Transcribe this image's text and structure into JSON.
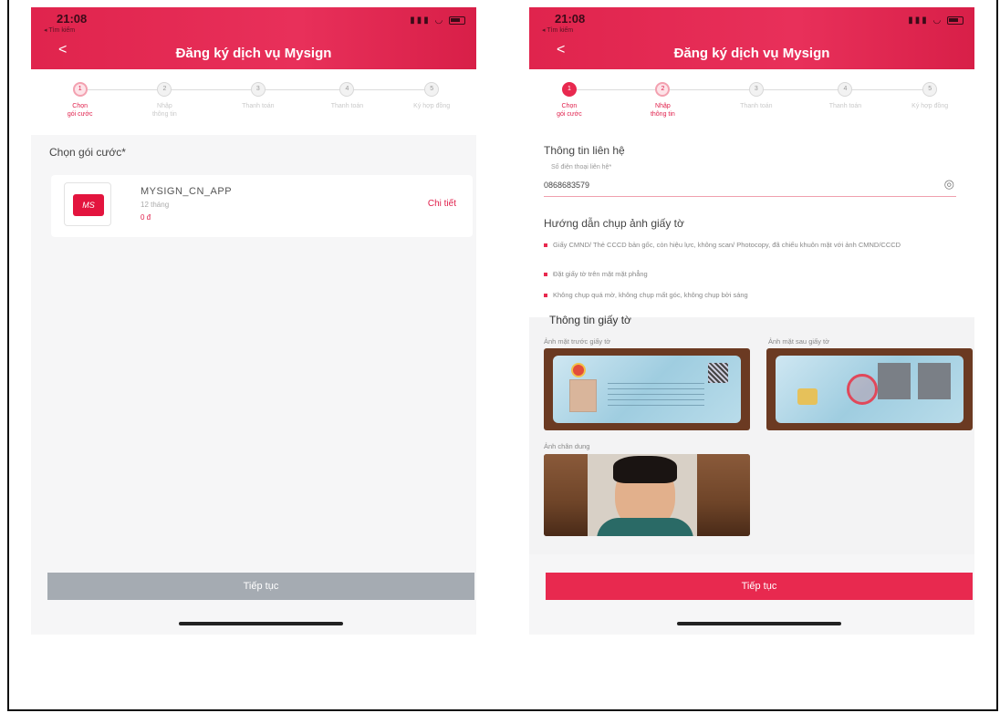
{
  "screens": [
    {
      "status_time": "21:08",
      "status_sub": "◂ Tìm kiếm",
      "header_title": "Đăng ký dịch vụ Mysign",
      "steps": [
        {
          "num": "1",
          "label": "Chọn\ngói cước",
          "state": "active"
        },
        {
          "num": "2",
          "label": "Nhập\nthông tin",
          "state": "pending"
        },
        {
          "num": "3",
          "label": "Thanh toán",
          "state": "pending"
        },
        {
          "num": "4",
          "label": "Thanh toán",
          "state": "pending"
        },
        {
          "num": "5",
          "label": "Ký hợp đồng",
          "state": "pending"
        }
      ],
      "section_title": "Chọn gói cước*",
      "package": {
        "logo_text": "MS",
        "name": "MYSIGN_CN_APP",
        "duration": "12 tháng",
        "price": "0 đ",
        "detail_label": "Chi tiết"
      },
      "continue_label": "Tiếp tục",
      "continue_enabled": false
    },
    {
      "status_time": "21:08",
      "status_sub": "◂ Tìm kiếm",
      "header_title": "Đăng ký dịch vụ Mysign",
      "steps": [
        {
          "num": "1",
          "label": "Chọn\ngói cước",
          "state": "done"
        },
        {
          "num": "2",
          "label": "Nhập\nthông tin",
          "state": "active"
        },
        {
          "num": "3",
          "label": "Thanh toán",
          "state": "pending"
        },
        {
          "num": "4",
          "label": "Thanh toán",
          "state": "pending"
        },
        {
          "num": "5",
          "label": "Ký hợp đồng",
          "state": "pending"
        }
      ],
      "contact_title": "Thông tin liên hệ",
      "phone_hint": "Số điện thoại liên hệ*",
      "phone_value": "0868683579",
      "guide_title": "Hướng dẫn chụp ảnh giấy tờ",
      "guide_items": [
        "Giấy CMND/ Thẻ CCCD bản gốc, còn hiệu lực, không scan/ Photocopy, đã chiếu khuôn mặt với ảnh CMND/CCCD",
        "Đặt giấy tờ trên mặt mặt phẳng",
        "Không chụp quá mờ, không chụp mất góc, không chụp bởi sáng"
      ],
      "doc_title": "Thông tin giấy tờ",
      "front_label": "Ảnh mặt trước giấy tờ",
      "back_label": "Ảnh mặt sau giấy tờ",
      "portrait_label": "Ảnh chân dung",
      "continue_label": "Tiếp tục",
      "continue_enabled": true
    }
  ],
  "colors": {
    "brand_red": "#e8294f",
    "disabled_gray": "#a5abb2"
  }
}
